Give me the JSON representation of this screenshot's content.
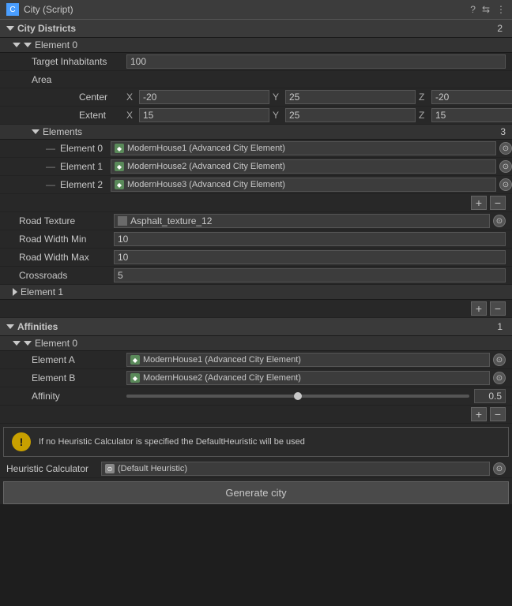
{
  "titleBar": {
    "title": "City (Script)",
    "iconText": "C"
  },
  "cityDistricts": {
    "label": "City Districts",
    "badge": "2"
  },
  "element0": {
    "label": "Element 0",
    "targetInhabitants": {
      "label": "Target Inhabitants",
      "value": "100"
    },
    "area": {
      "label": "Area",
      "center": {
        "label": "Center",
        "x": "-20",
        "y": "25",
        "z": "-20"
      },
      "extent": {
        "label": "Extent",
        "x": "15",
        "y": "25",
        "z": "15"
      }
    },
    "elements": {
      "label": "Elements",
      "badge": "3",
      "items": [
        {
          "label": "Element 0",
          "ref": "ModernHouse1 (Advanced City Element)"
        },
        {
          "label": "Element 1",
          "ref": "ModernHouse2 (Advanced City Element)"
        },
        {
          "label": "Element 2",
          "ref": "ModernHouse3 (Advanced City Element)"
        }
      ]
    },
    "roadTexture": {
      "label": "Road Texture",
      "value": "Asphalt_texture_12"
    },
    "roadWidthMin": {
      "label": "Road Width Min",
      "value": "10"
    },
    "roadWidthMax": {
      "label": "Road Width Max",
      "value": "10"
    },
    "crossroads": {
      "label": "Crossroads",
      "value": "5"
    }
  },
  "element1": {
    "label": "Element 1"
  },
  "addRemove": {
    "add": "+",
    "remove": "-"
  },
  "affinities": {
    "label": "Affinities",
    "badge": "1",
    "element0": {
      "label": "Element 0",
      "elementA": {
        "label": "Element A",
        "ref": "ModernHouse1 (Advanced City Element)"
      },
      "elementB": {
        "label": "Element B",
        "ref": "ModernHouse2 (Advanced City Element)"
      },
      "affinity": {
        "label": "Affinity",
        "value": "0.5",
        "fillPercent": 50
      }
    }
  },
  "warning": {
    "text": "If no Heuristic Calculator is specified the DefaultHeuristic will be used"
  },
  "heuristicCalculator": {
    "label": "Heuristic Calculator",
    "ref": "(Default Heuristic)"
  },
  "generateButton": {
    "label": "Generate city"
  }
}
